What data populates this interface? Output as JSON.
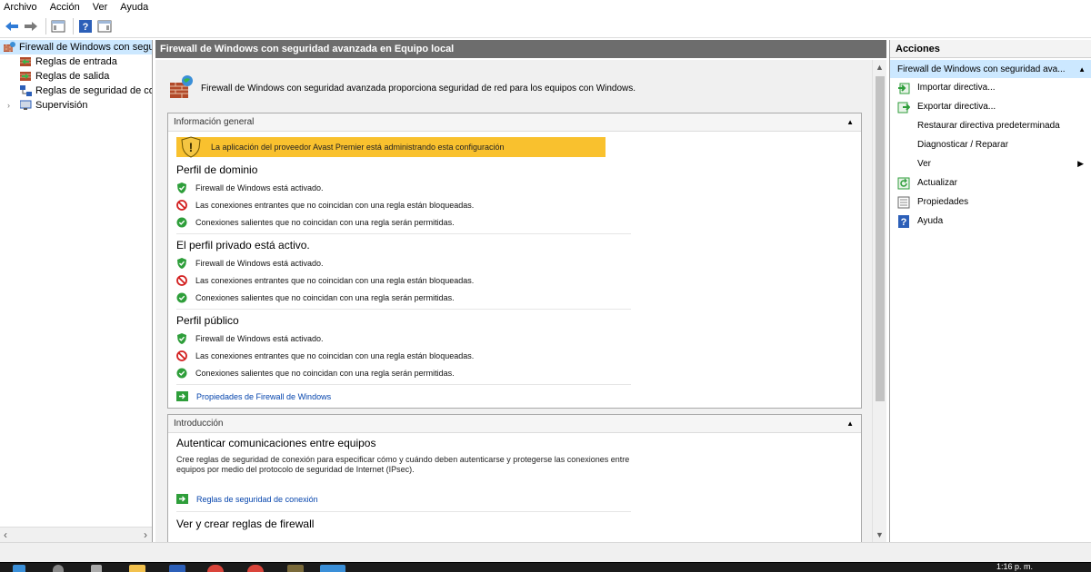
{
  "menu": [
    "Archivo",
    "Acción",
    "Ver",
    "Ayuda"
  ],
  "tree": {
    "root": "Firewall de Windows con segur",
    "children": [
      "Reglas de entrada",
      "Reglas de salida",
      "Reglas de seguridad de con",
      "Supervisión"
    ]
  },
  "center": {
    "header": "Firewall de Windows con seguridad avanzada en Equipo local",
    "intro": "Firewall de Windows con seguridad avanzada proporciona seguridad de red para los equipos con Windows.",
    "overview": {
      "title": "Información general",
      "warning": "La aplicación del proveedor Avast Premier está administrando esta configuración",
      "profiles": [
        {
          "title": "Perfil de dominio",
          "rows": [
            "Firewall de Windows está activado.",
            "Las conexiones entrantes que no coincidan con una regla están bloqueadas.",
            "Conexiones salientes que no coincidan con una regla serán permitidas."
          ]
        },
        {
          "title": "El perfil privado está activo.",
          "rows": [
            "Firewall de Windows está activado.",
            "Las conexiones entrantes que no coincidan con una regla están bloqueadas.",
            "Conexiones salientes que no coincidan con una regla serán permitidas."
          ]
        },
        {
          "title": "Perfil público",
          "rows": [
            "Firewall de Windows está activado.",
            "Las conexiones entrantes que no coincidan con una regla están bloqueadas.",
            "Conexiones salientes que no coincidan con una regla serán permitidas."
          ]
        }
      ],
      "link": "Propiedades de Firewall de Windows"
    },
    "introduction": {
      "title": "Introducción",
      "section1_title": "Autenticar comunicaciones entre equipos",
      "section1_text": "Cree reglas de seguridad de conexión para especificar cómo y cuándo deben autenticarse y protegerse las conexiones entre equipos por medio del protocolo de seguridad de Internet (IPsec).",
      "section1_link": "Reglas de seguridad de conexión",
      "section2_title": "Ver y crear reglas de firewall"
    }
  },
  "actions": {
    "header": "Acciones",
    "group": "Firewall de Windows con seguridad ava...",
    "items": [
      "Importar directiva...",
      "Exportar directiva...",
      "Restaurar directiva predeterminada",
      "Diagnosticar / Reparar",
      "Ver",
      "Actualizar",
      "Propiedades",
      "Ayuda"
    ]
  },
  "taskbar": {
    "clock": "1:16 p. m."
  },
  "colors": {
    "accent": "#cce8ff",
    "warning": "#f9c12e",
    "header_bg": "#6d6d6d",
    "link": "#0645ad"
  }
}
